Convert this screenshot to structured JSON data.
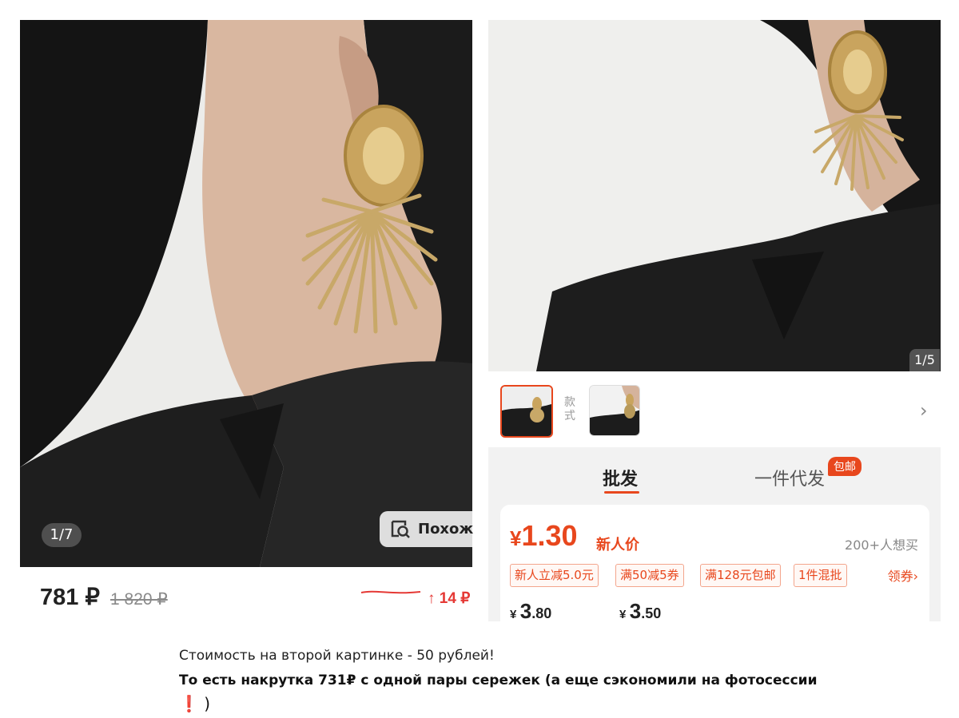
{
  "left_listing": {
    "image_counter": "1/7",
    "similar_button": "Похож",
    "price": "781 ₽",
    "old_price": "1 820 ₽",
    "trend": "↑ 14 ₽"
  },
  "right_listing": {
    "image_counter": "1/5",
    "style_label": "款式",
    "tabs": {
      "wholesale": "批发",
      "dropship": "一件代发",
      "free_shipping_badge": "包邮"
    },
    "price": {
      "symbol": "¥",
      "value": "1.30",
      "label": "新人价"
    },
    "want_count": "200+人想买",
    "coupons": [
      "新人立减5.0元",
      "满50减5券",
      "满128元包邮",
      "1件混批"
    ],
    "claim_coupon": "领券",
    "tiers": [
      {
        "symbol": "¥",
        "whole": "3",
        "fraction": ".80"
      },
      {
        "symbol": "¥",
        "whole": "3",
        "fraction": ".50"
      }
    ]
  },
  "caption": {
    "line1": "Стоимость на второй картинке - 50 рублей!",
    "line2": "То есть накрутка 731₽ с одной пары сережек (а еще сэкономили на фотосессии",
    "exclaim": "❗",
    "line3_end": ")"
  },
  "colors": {
    "accent": "#e8471d",
    "trend_red": "#e53935"
  }
}
